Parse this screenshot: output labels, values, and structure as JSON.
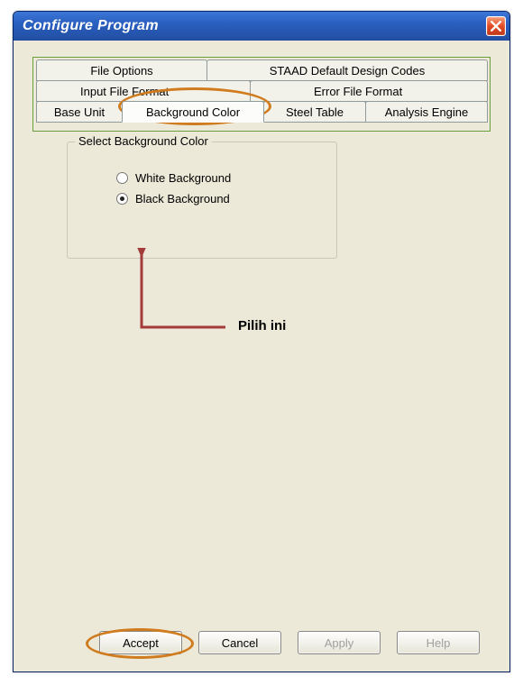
{
  "window": {
    "title": "Configure Program"
  },
  "tabs": {
    "row1": [
      {
        "label": "File Options"
      },
      {
        "label": "STAAD Default Design Codes"
      }
    ],
    "row2": [
      {
        "label": "Input File Format"
      },
      {
        "label": "Error File Format"
      }
    ],
    "row3": [
      {
        "label": "Base Unit"
      },
      {
        "label": "Background Color",
        "active": true
      },
      {
        "label": "Steel Table"
      },
      {
        "label": "Analysis Engine"
      }
    ]
  },
  "groupbox": {
    "title": "Select Background Color",
    "options": [
      {
        "label": "White Background",
        "checked": false
      },
      {
        "label": "Black Background",
        "checked": true
      }
    ]
  },
  "buttons": {
    "accept": "Accept",
    "cancel": "Cancel",
    "apply": "Apply",
    "help": "Help"
  },
  "annotation": {
    "label": "Pilih ini",
    "arrow_color": "#a33b3b",
    "ellipse_color": "#cf7b1e"
  }
}
